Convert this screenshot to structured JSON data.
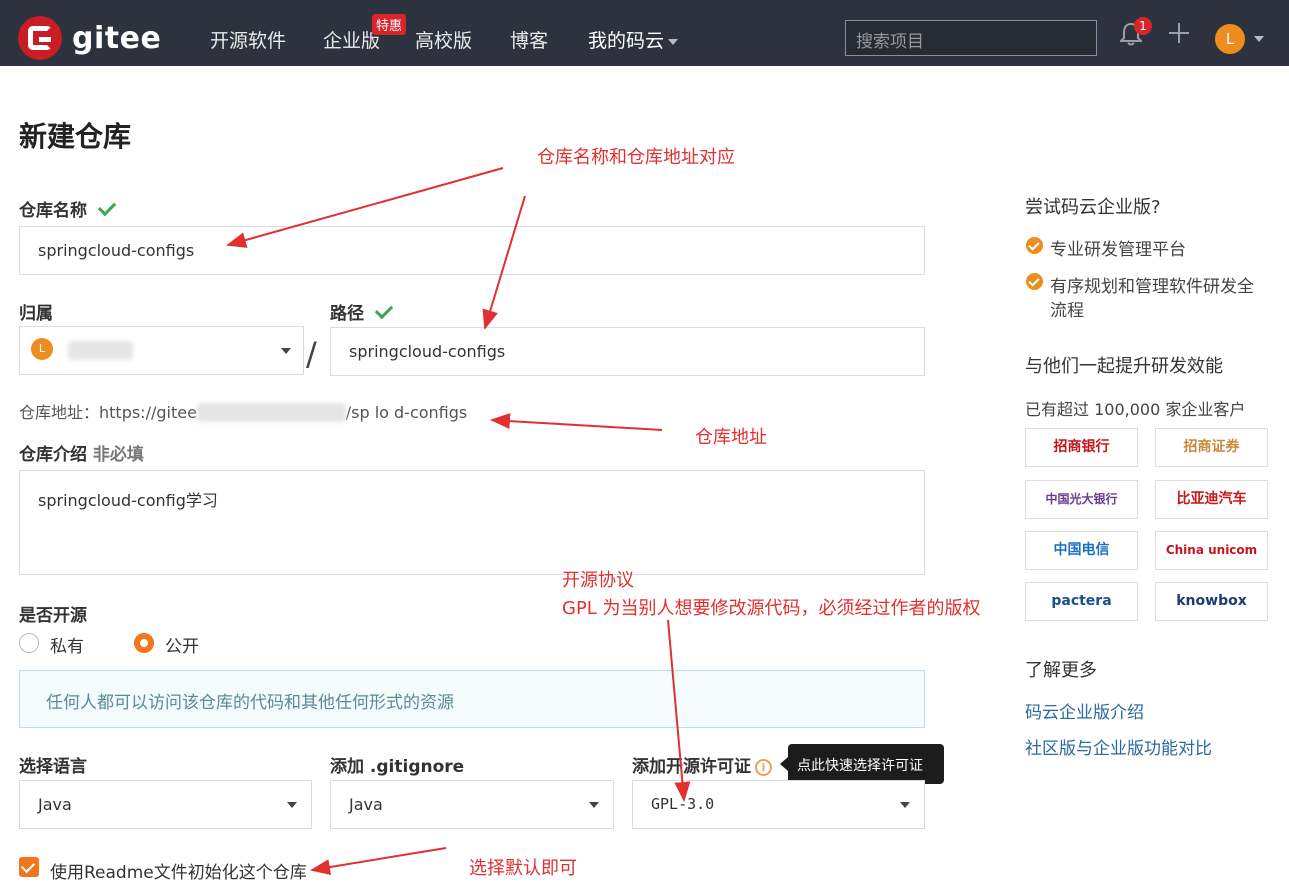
{
  "header": {
    "logo_text": "gitee",
    "nav": [
      "开源软件",
      "企业版",
      "高校版",
      "博客",
      "我的码云"
    ],
    "nav_badge": "特惠",
    "search_placeholder": "搜索项目",
    "notification_count": "1",
    "avatar_letter": "L"
  },
  "page": {
    "title": "新建仓库"
  },
  "form": {
    "repo_name_label": "仓库名称",
    "repo_name_value": "springcloud-configs",
    "owner_label": "归属",
    "owner_value": "mahjuct",
    "owner_avatar": "L",
    "slash": "/",
    "path_label": "路径",
    "path_value": "springcloud-configs",
    "repo_url_prefix": "仓库地址：https://gitee",
    "repo_url_suffix": "/sp      lo  d-configs",
    "intro_label": "仓库介绍",
    "intro_optional": "非必填",
    "intro_value": "springcloud-config学习",
    "open_source_label": "是否开源",
    "private_label": "私有",
    "public_label": "公开",
    "public_notice": "任何人都可以访问该仓库的代码和其他任何形式的资源",
    "language_label": "选择语言",
    "language_value": "Java",
    "gitignore_label": "添加 .gitignore",
    "gitignore_value": "Java",
    "license_label": "添加开源许可证",
    "license_value": "GPL-3.0",
    "license_tooltip": "点此快速选择许可证",
    "readme_label": "使用Readme文件初始化这个仓库"
  },
  "annotations": {
    "name_path": "仓库名称和仓库地址对应",
    "repo_url": "仓库地址",
    "license_title": "开源协议",
    "license_note": "GPL 为当别人想要修改源代码，必须经过作者的版权",
    "readme": "选择默认即可"
  },
  "sidebar": {
    "enterprise_title": "尝试码云企业版?",
    "features": [
      "专业研发管理平台",
      "有序规划和管理软件研发全",
      "流程"
    ],
    "promote_title": "与他们一起提升研发效能",
    "customers_text": "已有超过 100,000 家企业客户",
    "brands": [
      "招商银行",
      "招商证券",
      "中国光大银行",
      "比亚迪汽车",
      "中国电信",
      "China unicom",
      "pactera",
      "knowbox"
    ],
    "learn_more": "了解更多",
    "links": [
      "码云企业版介绍",
      "社区版与企业版功能对比"
    ]
  }
}
